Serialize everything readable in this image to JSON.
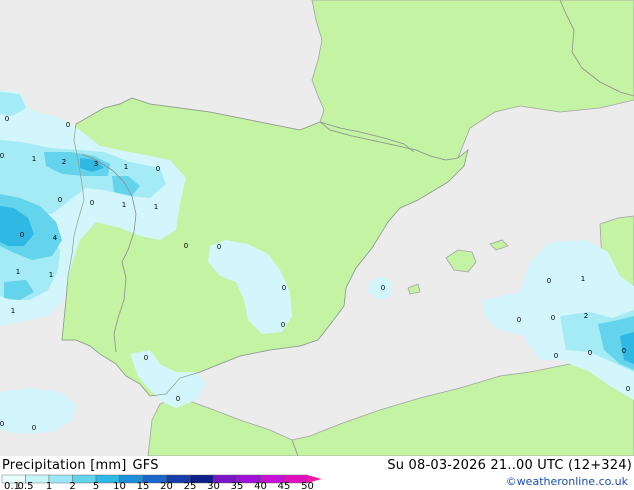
{
  "legend": {
    "title": "Precipitation [mm]",
    "model": "GFS",
    "timestamp": "Su 08-03-2026 21..00 UTC (12+324)",
    "credit": "©weatheronline.co.uk",
    "scale_ticks": [
      "0.1",
      "0.5",
      "1",
      "2",
      "5",
      "10",
      "15",
      "20",
      "25",
      "30",
      "35",
      "40",
      "45",
      "50"
    ],
    "scale_colors": [
      "#eafcfc",
      "#c8f5fa",
      "#9ae8f5",
      "#62d4ec",
      "#2fb8e4",
      "#1d8fd8",
      "#1a66cc",
      "#153eaa",
      "#0f1f8a",
      "#7a15c8",
      "#a010d8",
      "#c810d8",
      "#e010c0",
      "#f018a8"
    ]
  },
  "colors": {
    "sea": "#ececec",
    "land": "#c3f3a3",
    "border": "#8c8c8c",
    "coast": "#a3a3a3",
    "precip_light": "#d2f6fb",
    "precip_mid": "#a4ebf5",
    "precip_heavy": "#64d3ec",
    "precip_strong": "#2fb8e4"
  },
  "contour_labels": [
    "0",
    "0",
    "0",
    "1",
    "2",
    "3",
    "1",
    "0",
    "0",
    "0",
    "1",
    "1",
    "0",
    "4",
    "1",
    "1",
    "1",
    "0",
    "0",
    "0",
    "0",
    "0",
    "0",
    "0",
    "0",
    "0",
    "0",
    "1",
    "0",
    "0",
    "2",
    "0",
    "0",
    "0",
    "0"
  ]
}
